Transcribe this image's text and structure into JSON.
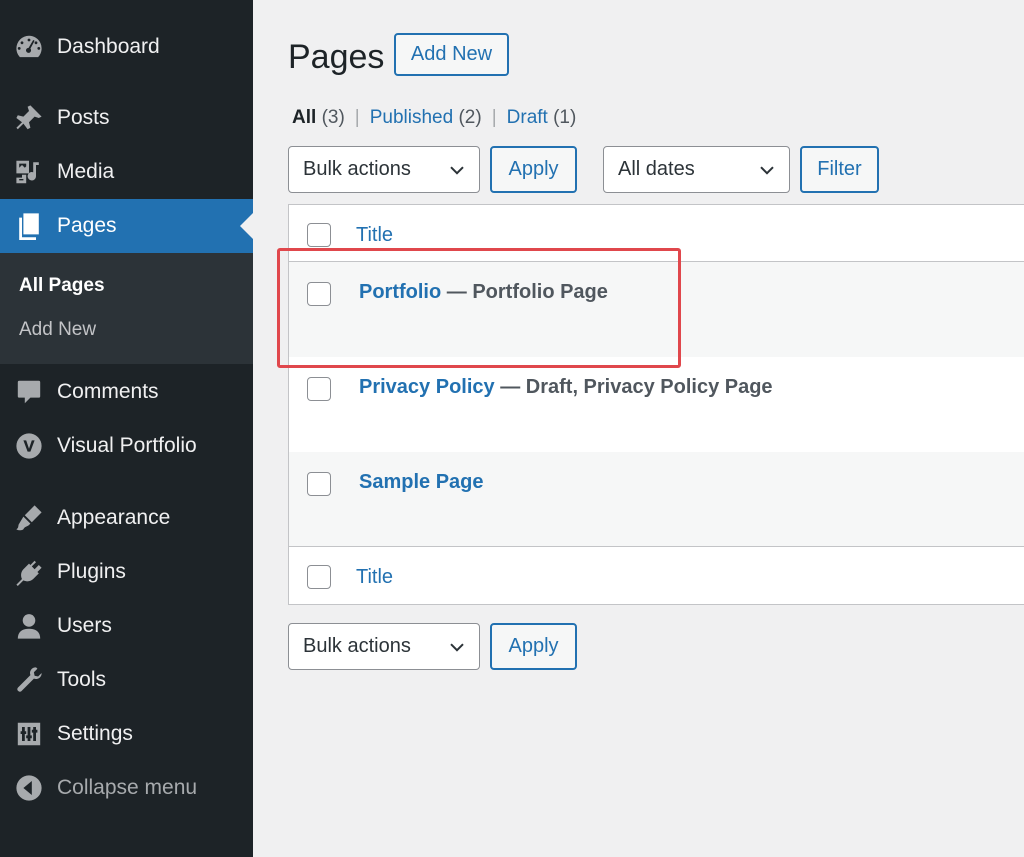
{
  "sidebar": {
    "items": [
      {
        "label": "Dashboard",
        "icon": "dashboard-icon"
      },
      {
        "label": "Posts",
        "icon": "pin-icon"
      },
      {
        "label": "Media",
        "icon": "media-icon"
      },
      {
        "label": "Pages",
        "icon": "pages-icon",
        "active": true
      },
      {
        "label": "Comments",
        "icon": "comment-icon"
      },
      {
        "label": "Visual Portfolio",
        "icon": "visual-portfolio-icon"
      },
      {
        "label": "Appearance",
        "icon": "brush-icon"
      },
      {
        "label": "Plugins",
        "icon": "plugin-icon"
      },
      {
        "label": "Users",
        "icon": "user-icon"
      },
      {
        "label": "Tools",
        "icon": "wrench-icon"
      },
      {
        "label": "Settings",
        "icon": "settings-sliders-icon"
      },
      {
        "label": "Collapse menu",
        "icon": "collapse-arrow-icon"
      }
    ],
    "submenu": [
      {
        "label": "All Pages",
        "current": true
      },
      {
        "label": "Add New"
      }
    ]
  },
  "header": {
    "title": "Pages",
    "add_new_label": "Add New"
  },
  "filters": {
    "all_label": "All",
    "all_count": "(3)",
    "published_label": "Published",
    "published_count": "(2)",
    "draft_label": "Draft",
    "draft_count": "(1)",
    "separator": "|"
  },
  "actions": {
    "bulk_label": "Bulk actions",
    "apply_label": "Apply",
    "dates_label": "All dates",
    "filter_label": "Filter"
  },
  "table": {
    "column_title": "Title",
    "rows": [
      {
        "title": "Portfolio",
        "state": " — Portfolio Page"
      },
      {
        "title": "Privacy Policy",
        "state": " — Draft, Privacy Policy Page"
      },
      {
        "title": "Sample Page",
        "state": ""
      }
    ]
  },
  "colors": {
    "sidebar_bg": "#1d2327",
    "accent": "#2271b1",
    "highlight": "#e0474c"
  }
}
